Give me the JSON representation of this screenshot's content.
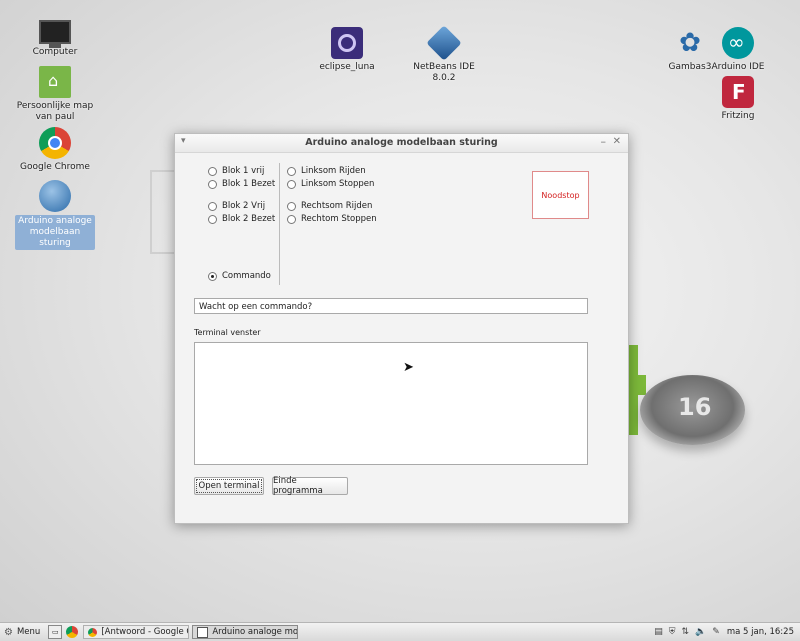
{
  "desktop": {
    "icons": [
      {
        "label": "Computer",
        "icon": "computer-icon"
      },
      {
        "label": "Persoonlijke map van paul",
        "icon": "home-folder-icon"
      },
      {
        "label": "Google Chrome",
        "icon": "chrome-icon"
      },
      {
        "label": "Arduino analoge modelbaan sturing",
        "icon": "arduino-app-icon"
      },
      {
        "label": "eclipse_luna",
        "icon": "eclipse-icon"
      },
      {
        "label": "NetBeans IDE 8.0.2",
        "icon": "netbeans-icon"
      },
      {
        "label": "Gambas3",
        "icon": "gambas-icon"
      },
      {
        "label": "Arduino IDE",
        "icon": "arduino-ide-icon"
      },
      {
        "label": "Fritzing",
        "icon": "fritzing-icon"
      }
    ],
    "logo_number": "16"
  },
  "window": {
    "title": "Arduino analoge modelbaan sturing",
    "radios_left": [
      {
        "label": "Blok 1 vrij",
        "checked": false
      },
      {
        "label": "Blok 1 Bezet",
        "checked": false
      },
      {
        "label": "Blok 2 Vrij",
        "checked": false
      },
      {
        "label": "Blok 2 Bezet",
        "checked": false
      },
      {
        "label": "Commando",
        "checked": true
      }
    ],
    "radios_right": [
      {
        "label": "Linksom Rijden",
        "checked": false
      },
      {
        "label": "Linksom Stoppen",
        "checked": false
      },
      {
        "label": "Rechtsom Rijden",
        "checked": false
      },
      {
        "label": "Rechtom Stoppen",
        "checked": false
      }
    ],
    "noodstop_label": "Noodstop",
    "command_value": "Wacht op een commando?",
    "terminal_label": "Terminal venster",
    "terminal_content": "",
    "buttons": {
      "open_terminal": "Open terminal",
      "end_program": "Einde programma"
    }
  },
  "taskbar": {
    "menu_label": "Menu",
    "tasks": [
      {
        "label": "[Antwoord - Google C...",
        "active": false
      },
      {
        "label": "Arduino analoge mode...",
        "active": true
      }
    ],
    "clock": "ma  5 jan, 16:25"
  },
  "colors": {
    "noodstop_text": "#d42020",
    "logo_green": "#7cb83a",
    "selection": "#8fb0d6"
  }
}
